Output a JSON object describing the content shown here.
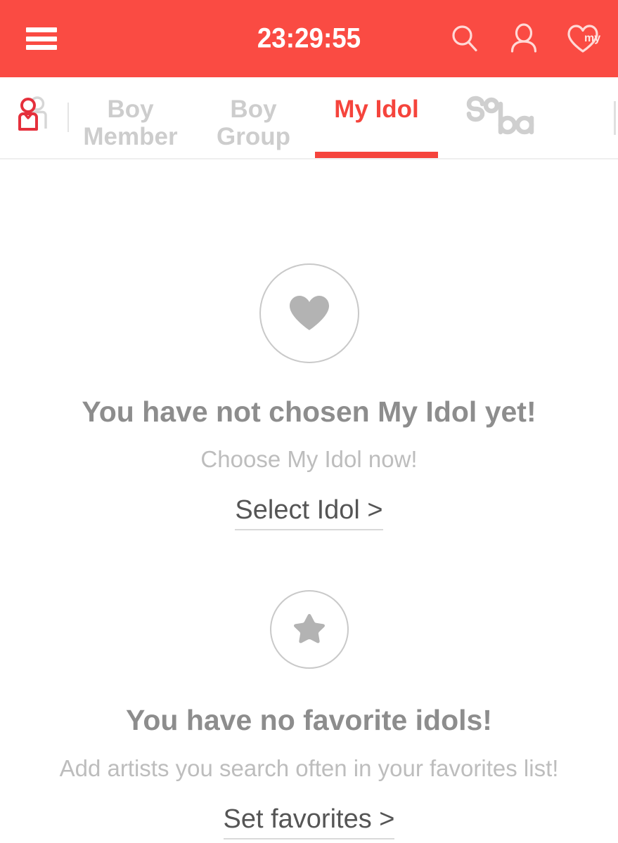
{
  "header": {
    "menu_icon": "hamburger-menu-icon",
    "clock": "23:29:55",
    "search_icon": "search-icon",
    "profile_icon": "user-profile-icon",
    "my_heart_icon": "my-heart-icon",
    "my_heart_label": "my",
    "background_color": "#fa4b43"
  },
  "tabs": {
    "leading_icon": "two-people-icon",
    "items": [
      {
        "label": "Boy\nMember",
        "active": false
      },
      {
        "label": "Boy\nGroup",
        "active": false
      },
      {
        "label": "My Idol",
        "active": true
      },
      {
        "label": "Soba",
        "active": false
      }
    ],
    "active_color": "#f5443c",
    "inactive_color": "#cdcdcd"
  },
  "main": {
    "my_idol": {
      "icon": "heart-icon",
      "title": "You have not chosen My Idol yet!",
      "subtitle": "Choose My Idol now!",
      "action_label": "Select Idol >"
    },
    "favorites": {
      "icon": "star-icon",
      "title": "You have no favorite idols!",
      "subtitle": "Add artists you search often in your favorites list!",
      "action_label": "Set favorites >"
    }
  }
}
